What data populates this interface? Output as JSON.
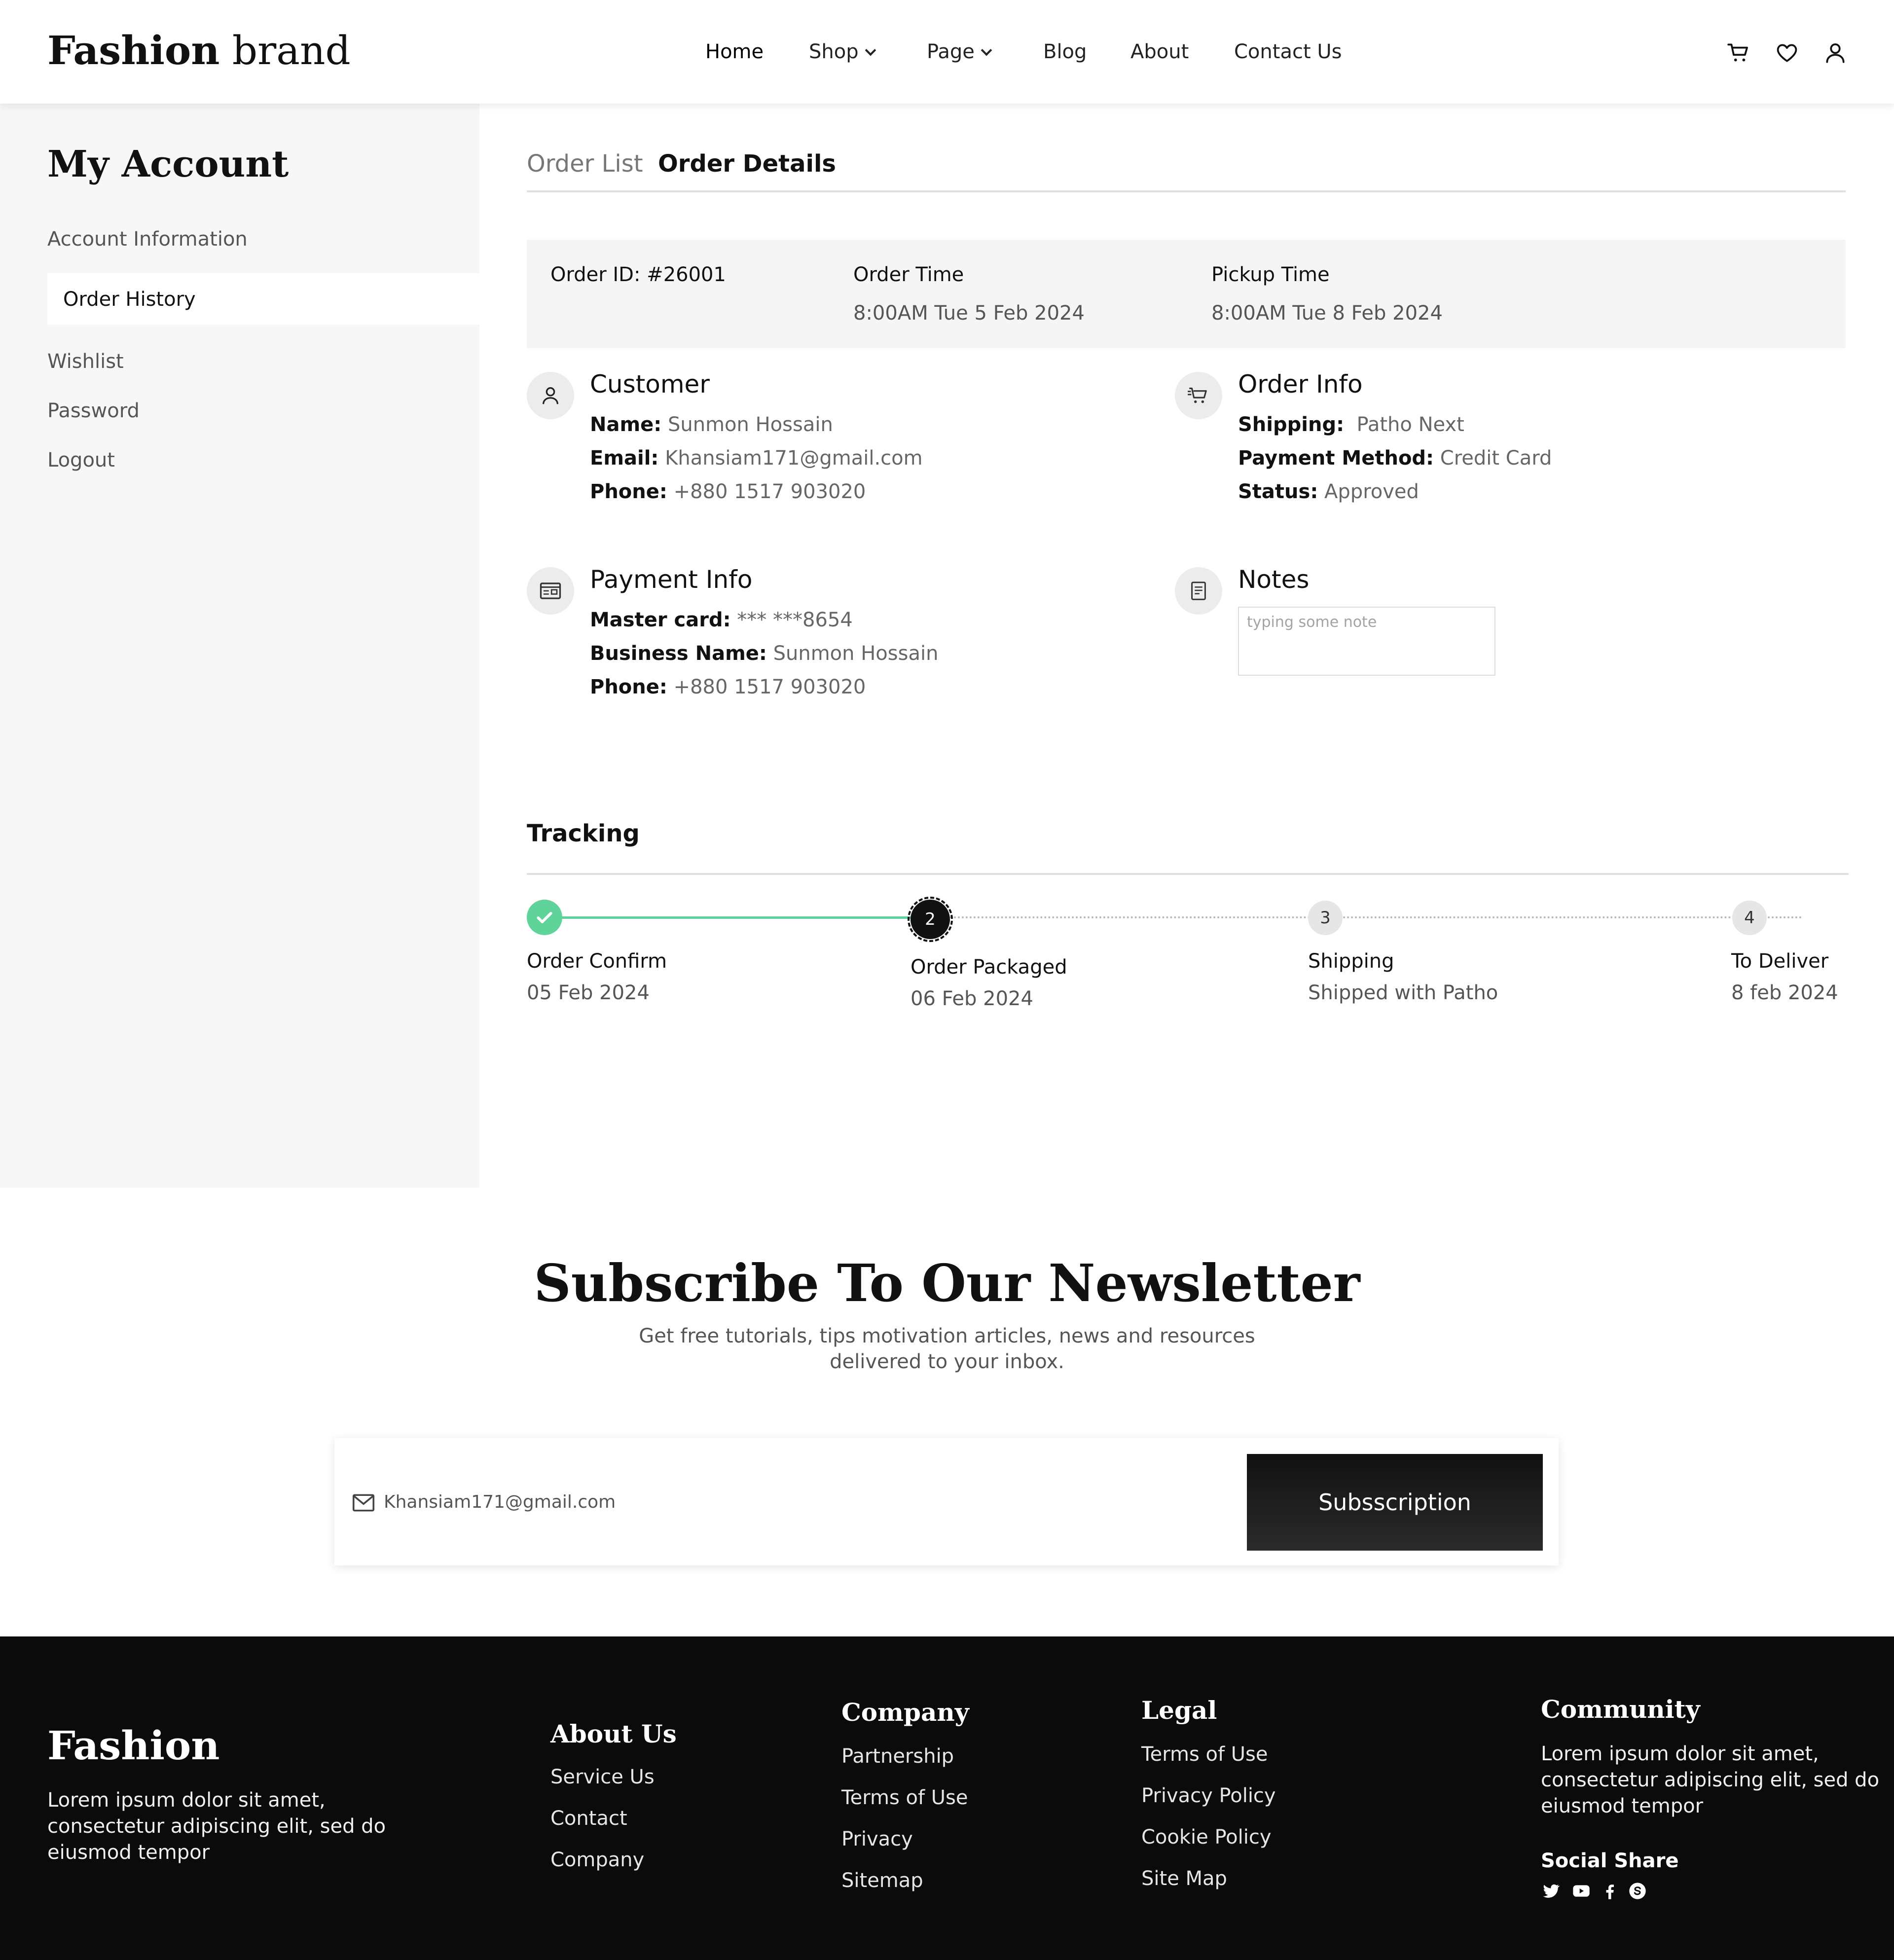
{
  "header": {
    "brand_bold": "Fashion",
    "brand_light": "brand",
    "nav": [
      {
        "label": "Home"
      },
      {
        "label": "Shop"
      },
      {
        "label": "Page"
      },
      {
        "label": "Blog"
      },
      {
        "label": "About"
      },
      {
        "label": "Contact Us"
      }
    ],
    "icons": [
      "cart-icon",
      "heart-icon",
      "user-icon"
    ]
  },
  "sidebar": {
    "title": "My Account",
    "items": [
      {
        "label": "Account Information"
      },
      {
        "label": "Order History"
      },
      {
        "label": "Wishlist"
      },
      {
        "label": "Password"
      },
      {
        "label": "Logout"
      }
    ],
    "active": "Order History"
  },
  "tabs": [
    {
      "label": "Order List"
    },
    {
      "label": "Order Details"
    }
  ],
  "order": {
    "id_label": "Order ID: #26001",
    "order_time_label": "Order Time",
    "order_time": "8:00AM Tue 5 Feb 2024",
    "pickup_time_label": "Pickup Time",
    "pickup_time": "8:00AM Tue 8 Feb 2024"
  },
  "customer": {
    "title": "Customer",
    "name_label": "Name:",
    "name": "Sunmon Hossain",
    "email_label": "Email:",
    "email": "Khansiam171@gmail.com",
    "phone_label": "Phone:",
    "phone": "+880 1517 903020"
  },
  "order_info": {
    "title": "Order Info",
    "shipping_label": "Shipping:",
    "shipping": "Patho Next",
    "payment_label": "Payment Method:",
    "payment": "Credit Card",
    "status_label": "Status:",
    "status": "Approved"
  },
  "payment_info": {
    "title": "Payment Info",
    "card_label": "Master card:",
    "card": "*** ***8654",
    "business_label": "Business Name:",
    "business": "Sunmon Hossain",
    "phone_label": "Phone:",
    "phone": "+880 1517 903020"
  },
  "notes": {
    "title": "Notes",
    "placeholder": "typing some note"
  },
  "tracking": {
    "title": "Tracking",
    "steps": [
      {
        "number": "",
        "label": "Order Confirm",
        "sub": "05 Feb 2024",
        "state": "done"
      },
      {
        "number": "2",
        "label": "Order Packaged",
        "sub": "06 Feb 2024",
        "state": "current"
      },
      {
        "number": "3",
        "label": "Shipping",
        "sub": "Shipped with Patho",
        "state": "pending"
      },
      {
        "number": "4",
        "label": "To Deliver",
        "sub": "8 feb 2024",
        "state": "pending"
      }
    ],
    "colors": {
      "done": "#5fd39a",
      "current": "#111111",
      "pending": "#e6e6e6"
    }
  },
  "newsletter": {
    "title": "Subscribe To Our Newsletter",
    "sub_line1": "Get free tutorials, tips motivation articles, news and resources",
    "sub_line2": "delivered to your inbox.",
    "email_value": "Khansiam171@gmail.com",
    "button": "Subsscription"
  },
  "footer": {
    "brand": "Fashion",
    "brand_text": [
      "Lorem ipsum dolor sit amet,",
      "consectetur adipiscing elit, sed do",
      "eiusmod tempor"
    ],
    "about": {
      "title": "About Us",
      "links": [
        "Service Us",
        "Contact",
        "Company"
      ]
    },
    "company": {
      "title": "Company",
      "links": [
        "Partnership",
        "Terms of Use",
        "Privacy",
        "Sitemap"
      ]
    },
    "legal": {
      "title": "Legal",
      "links": [
        "Terms of Use",
        "Privacy Policy",
        "Cookie Policy",
        "Site Map"
      ]
    },
    "community": {
      "title": "Community",
      "text": [
        "Lorem ipsum dolor sit amet,",
        "consectetur adipiscing elit, sed do",
        "eiusmod tempor"
      ],
      "social_title": "Social Share",
      "social": [
        "twitter-icon",
        "youtube-icon",
        "facebook-icon",
        "skype-icon"
      ]
    }
  }
}
